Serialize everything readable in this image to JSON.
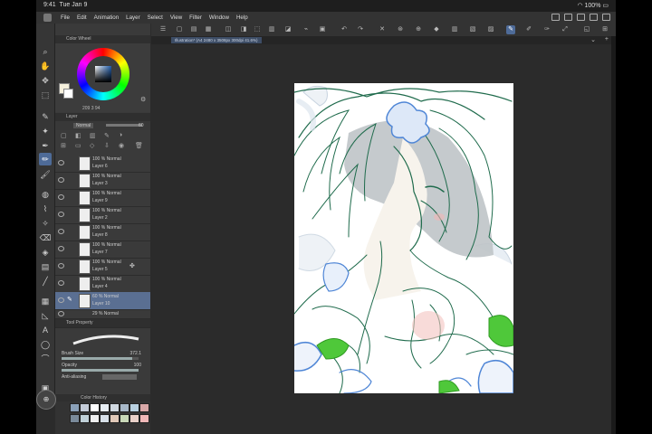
{
  "status": {
    "time": "9:41",
    "date": "Tue Jan 9",
    "battery": "100%"
  },
  "menu": [
    "File",
    "Edit",
    "Animation",
    "Layer",
    "Select",
    "View",
    "Filter",
    "Window",
    "Help"
  ],
  "palettes": {
    "color_wheel": "Color Wheel",
    "layer": "Layer",
    "tool_property": "Tool Property",
    "color_history": "Color History"
  },
  "color_readout": "209  3  94",
  "layer_panel": {
    "blend_mode": "Normal",
    "opacity": "60"
  },
  "layers": [
    {
      "opacity": "100 % Normal",
      "name": "Layer 6"
    },
    {
      "opacity": "100 % Normal",
      "name": "Layer 3"
    },
    {
      "opacity": "100 % Normal",
      "name": "Layer 9"
    },
    {
      "opacity": "100 % Normal",
      "name": "Layer 2"
    },
    {
      "opacity": "100 % Normal",
      "name": "Layer 8"
    },
    {
      "opacity": "100 % Normal",
      "name": "Layer 7"
    },
    {
      "opacity": "100 % Normal",
      "name": "Layer 5"
    },
    {
      "opacity": "100 % Normal",
      "name": "Layer 4"
    },
    {
      "opacity": "60 % Normal",
      "name": "Layer 10"
    },
    {
      "opacity": "29 % Normal",
      "name": ""
    }
  ],
  "tool_property": {
    "brush_size_label": "Brush Size",
    "brush_size_value": "372.1",
    "opacity_label": "Opacity",
    "opacity_value": "100",
    "antialiasing_label": "Anti-aliasing"
  },
  "canvas_tab": "Illustration* (A4 2480 x 3508px 300dpi 41.6%)",
  "colors": {
    "accent": "#4e6b98",
    "sketch_green": "#1f6b4c",
    "sketch_blue": "#4f86d6",
    "sketch_light_green": "#4fc83a",
    "history": [
      "#8aa0b8",
      "#c4ccd8",
      "#ffffff",
      "#e8eef4",
      "#d0d8e0",
      "#a8b8c8",
      "#b8d0e0",
      "#d8a8a8",
      "#7a8a9a",
      "#c0d0d8",
      "#f0f0f0",
      "#d8e0e8",
      "#e0c8b8",
      "#c8d8b8",
      "#e8d0c8",
      "#f0b8b8"
    ]
  }
}
